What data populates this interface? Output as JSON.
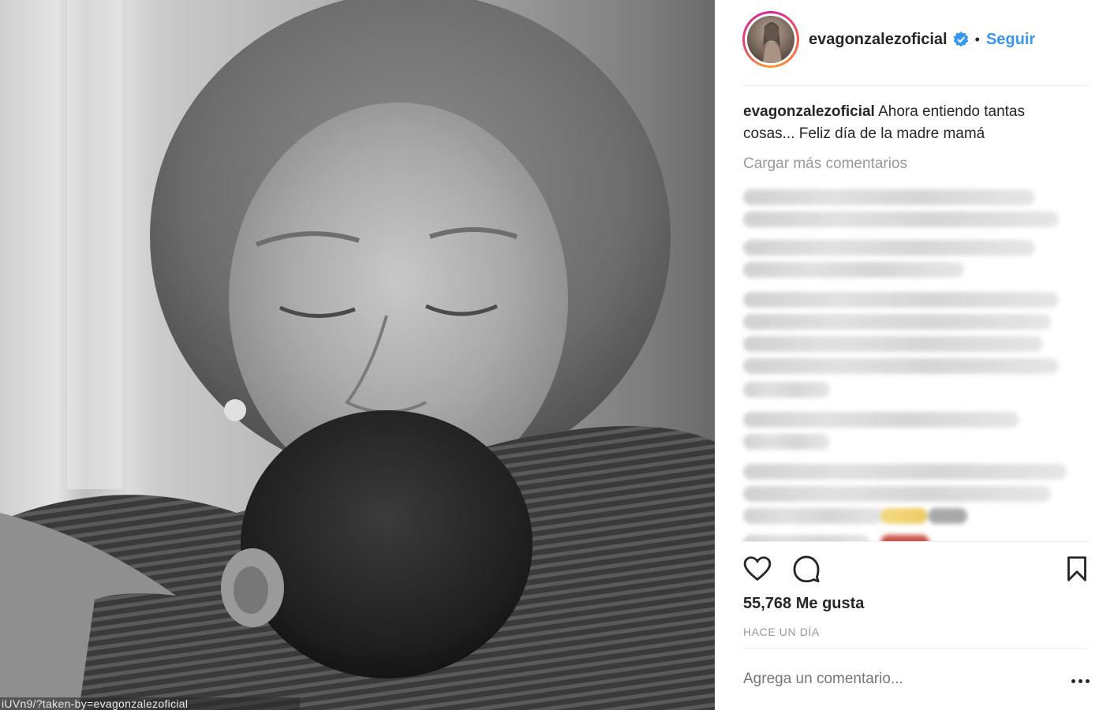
{
  "post": {
    "username": "evagonzalezoficial",
    "follow_label": "Seguir",
    "separator": "•",
    "caption_user": "evagonzalezoficial",
    "caption_text": "Ahora entiendo tantas cosas... Feliz día de la madre mamá",
    "load_more_label": "Cargar más comentarios",
    "likes": "55,768 Me gusta",
    "timestamp": "HACE UN DÍA",
    "comment_placeholder": "Agrega un comentario...",
    "photo_watermark": "iUVn9/?taken-by=evagonzalezoficial"
  },
  "icons": {
    "verified": "verified-badge-icon",
    "like": "heart-icon",
    "comment": "comment-bubble-icon",
    "save": "bookmark-icon",
    "more": "more-options-icon"
  },
  "colors": {
    "link": "#3897f0",
    "text": "#262626",
    "muted": "#999999",
    "divider": "#efefef"
  }
}
